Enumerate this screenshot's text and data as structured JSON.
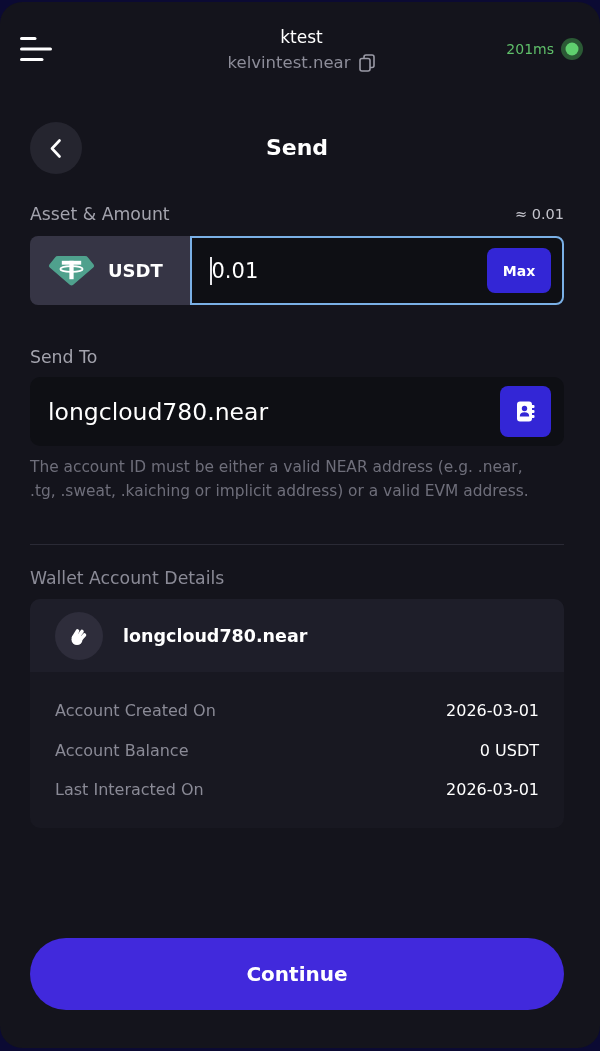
{
  "header": {
    "title": "ktest",
    "account": "kelvintest.near",
    "latency": "201ms",
    "connected": true
  },
  "page": {
    "title": "Send"
  },
  "asset_amount": {
    "label": "Asset & Amount",
    "estimate": "≈ 0.01",
    "asset": "USDT",
    "amount": "0.01",
    "focused": true,
    "max_button": "Max"
  },
  "send_to": {
    "label": "Send To",
    "value": "longcloud780.near",
    "hint": "The account ID must be either a valid NEAR address (e.g. .near, .tg, .sweat, .kaiching or implicit address) or a valid EVM address."
  },
  "wallet_details": {
    "label": "Wallet Account Details",
    "account": "longcloud780.near",
    "rows": [
      {
        "label": "Account Created On",
        "value": "2026-03-01"
      },
      {
        "label": "Account Balance",
        "value": "0 USDT"
      },
      {
        "label": "Last Interacted On",
        "value": "2026-03-01"
      }
    ]
  },
  "continue_button": "Continue"
}
